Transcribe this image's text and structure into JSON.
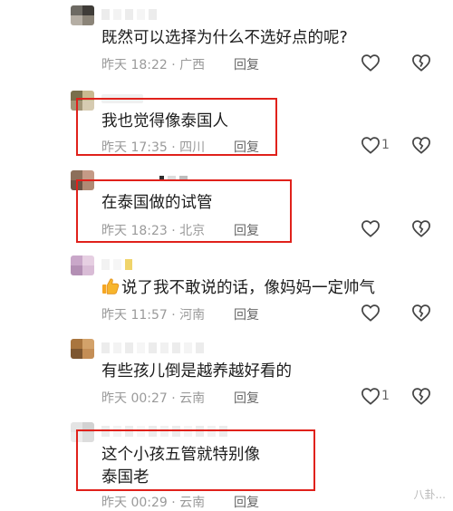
{
  "comments": [
    {
      "text": "既然可以选择为什么不选好点的呢?",
      "time": "昨天 18:22",
      "location": "广西",
      "reply": "回复",
      "likes": ""
    },
    {
      "text": "我也觉得像泰国人",
      "time": "昨天 17:35",
      "location": "四川",
      "reply": "回复",
      "likes": "1"
    },
    {
      "text": "在泰国做的试管",
      "time": "昨天 18:23",
      "location": "北京",
      "reply": "回复",
      "likes": ""
    },
    {
      "text": "说了我不敢说的话，像妈妈一定帅气",
      "time": "昨天 11:57",
      "location": "河南",
      "reply": "回复",
      "likes": ""
    },
    {
      "text": "有些孩儿倒是越养越好看的",
      "time": "昨天 00:27",
      "location": "云南",
      "reply": "回复",
      "likes": "1"
    },
    {
      "text_line1": "这个小孩五管就特别像",
      "text_line2": "泰国老",
      "time": "昨天 00:29",
      "location": "云南",
      "reply": "回复",
      "likes": ""
    }
  ],
  "separator": " · ",
  "watermark": "八卦..."
}
